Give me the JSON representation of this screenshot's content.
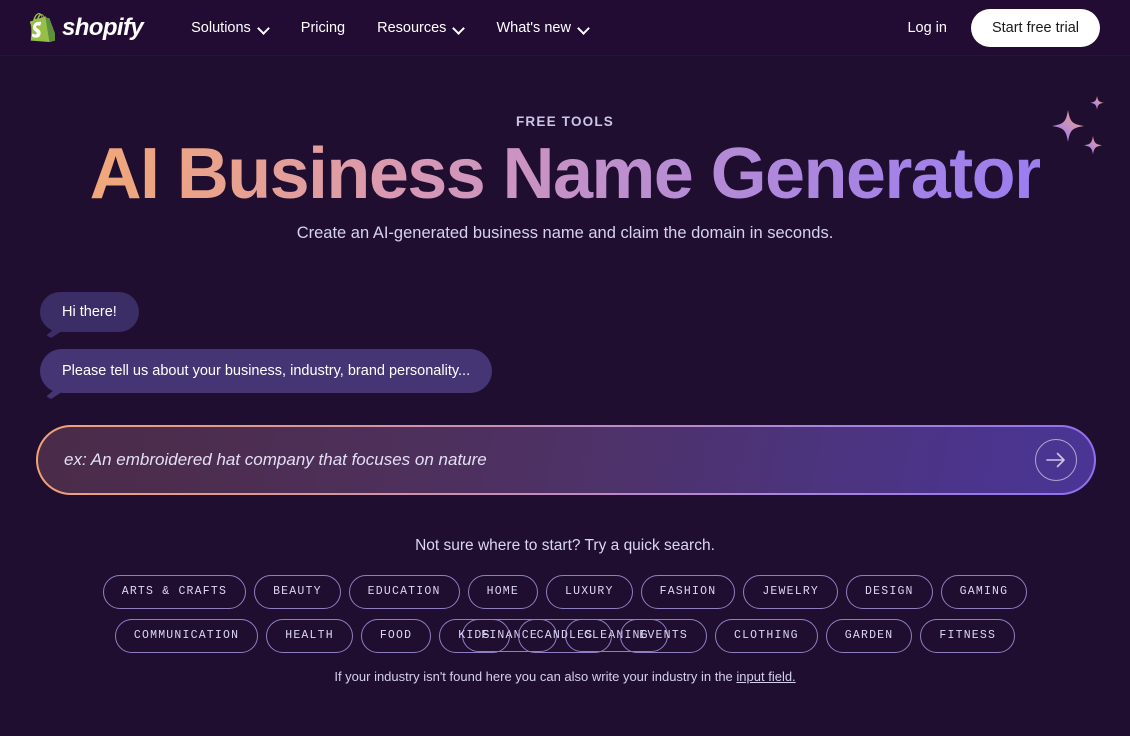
{
  "header": {
    "brand_name": "shopify",
    "brand_logo_icon": "shopify-bag-icon",
    "nav": [
      {
        "label": "Solutions",
        "has_chevron": true
      },
      {
        "label": "Pricing",
        "has_chevron": false
      },
      {
        "label": "Resources",
        "has_chevron": true
      },
      {
        "label": "What's new",
        "has_chevron": true
      }
    ],
    "login_label": "Log in",
    "trial_label": "Start free trial"
  },
  "hero": {
    "eyebrow": "FREE TOOLS",
    "title": "AI Business Name Generator",
    "subtitle": "Create an AI-generated business name and claim the domain in seconds.",
    "sparkle_icon": "sparkles-icon"
  },
  "chat": {
    "bubbles": [
      {
        "text": "Hi there!"
      },
      {
        "text": "Please tell us about your business, industry, brand personality..."
      }
    ]
  },
  "input": {
    "placeholder": "ex: An embroidered hat company that focuses on nature",
    "value": "",
    "submit_icon": "arrow-right-icon"
  },
  "quick_search": {
    "hint": "Not sure where to start? Try a quick search.",
    "row1": [
      "ARTS & CRAFTS",
      "BEAUTY",
      "EDUCATION",
      "HOME",
      "LUXURY",
      "FASHION",
      "JEWELRY",
      "DESIGN",
      "GAMING",
      "FINANCE",
      "CLEANING"
    ],
    "row2": [
      "COMMUNICATION",
      "HEALTH",
      "FOOD",
      "KIDS",
      "CANDLES",
      "EVENTS",
      "CLOTHING",
      "GARDEN",
      "FITNESS"
    ],
    "footnote_prefix": "If your industry isn't found here you can also write your industry in the ",
    "footnote_link": "input field."
  },
  "colors": {
    "background": "#1f0e2f",
    "header_bg": "#220c34",
    "accent_orange": "#f2a277",
    "accent_purple": "#8f6ff0",
    "bubble": "#3b2d66",
    "chip_border": "#8f7fc2",
    "brand_green": "#95bf47"
  }
}
